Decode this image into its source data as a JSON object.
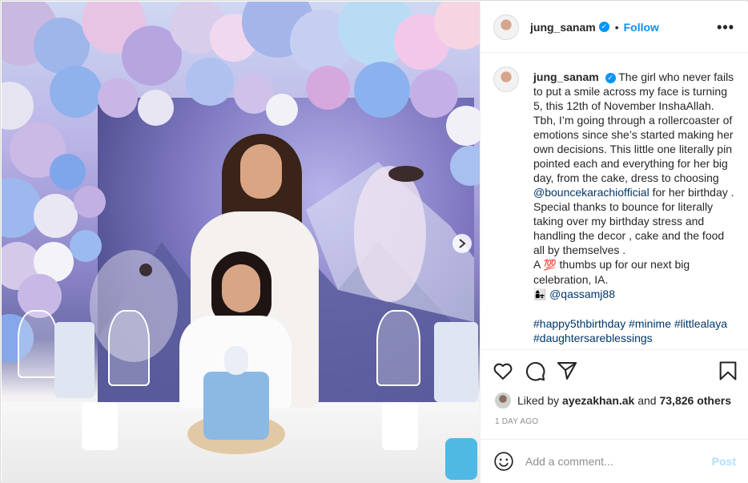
{
  "post": {
    "username": "jung_sanam",
    "verified": true,
    "separator": "•",
    "follow_label": "Follow",
    "more_icon": "more-horizontal-icon",
    "next_icon": "chevron-right-icon"
  },
  "caption": {
    "username": "jung_sanam",
    "line1": "The girl who never fails to put a smile across my face is turning 5, this 12th of November InshaAllah. Tbh, I’m going through a rollercoaster of emotions since she’s started making her own decisions. This little one literally pin pointed each and everything for her big day, from the cake, dress to choosing",
    "mention1": "@bouncekarachiofficial",
    "line2": "for her birthday . Special thanks to bounce for literally taking over my birthday stress and handling the decor , cake and the food all by themselves .",
    "line3_start": "A",
    "heart_emoji": "💯",
    "line3_end": "thumbs up for our next big celebration, IA.",
    "couple_emoji": "👩‍👧",
    "mention2": "@qassamj88",
    "hashtags": [
      "#happy5thbirthday",
      "#minime",
      "#littlealaya",
      "#daughtersareblessings"
    ]
  },
  "actions": {
    "like_icon": "heart-icon",
    "comment_icon": "comment-icon",
    "share_icon": "send-icon",
    "save_icon": "bookmark-icon"
  },
  "likes": {
    "prefix": "Liked by",
    "user": "ayezakhan.ak",
    "joiner": "and",
    "count": "73,826 others"
  },
  "timestamp": "1 DAY AGO",
  "comment_box": {
    "placeholder": "Add a comment...",
    "post_label": "Post",
    "emoji_icon": "smiley-icon"
  },
  "colors": {
    "link": "#00376b",
    "accent": "#0095f6",
    "post_disabled": "#b2dffc"
  }
}
